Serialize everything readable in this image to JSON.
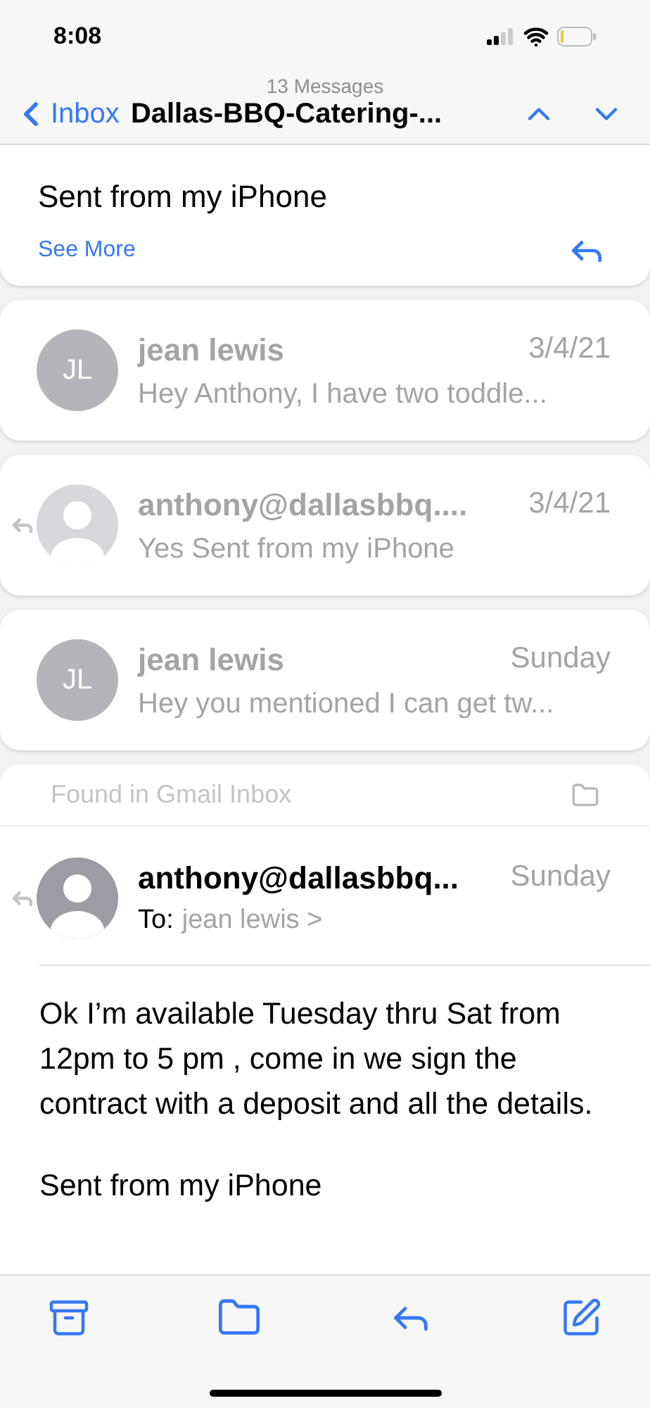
{
  "status_bar": {
    "time": "8:08"
  },
  "nav": {
    "back_label": "Inbox",
    "count": "13 Messages",
    "title": "Dallas-BBQ-Catering-..."
  },
  "top_message": {
    "body": "Sent from my iPhone",
    "more_link": "See More"
  },
  "messages": [
    {
      "sender": "jean lewis",
      "date": "3/4/21",
      "preview": "Hey Anthony, I have two toddle...",
      "avatar": {
        "kind": "initials",
        "initials": "JL"
      },
      "replied": false
    },
    {
      "sender": "anthony@dallasbbq....",
      "date": "3/4/21",
      "preview": "Yes Sent from my iPhone",
      "avatar": {
        "kind": "silhouette"
      },
      "replied": true
    },
    {
      "sender": "jean lewis",
      "date": "Sunday",
      "preview": "Hey you mentioned I can get tw...",
      "avatar": {
        "kind": "initials",
        "initials": "JL"
      },
      "replied": false
    }
  ],
  "folder_note": "Found in Gmail Inbox",
  "open_message": {
    "sender": "anthony@dallasbbq...",
    "date": "Sunday",
    "to_label": "To:",
    "to_name": "jean lewis",
    "to_chevron": ">",
    "avatar": {
      "kind": "silhouette"
    },
    "replied": true,
    "paragraphs": [
      "Ok I’m available Tuesday thru Sat from 12pm to 5 pm , come in we sign the contract with a deposit and all the details.",
      "Sent from my iPhone"
    ]
  }
}
